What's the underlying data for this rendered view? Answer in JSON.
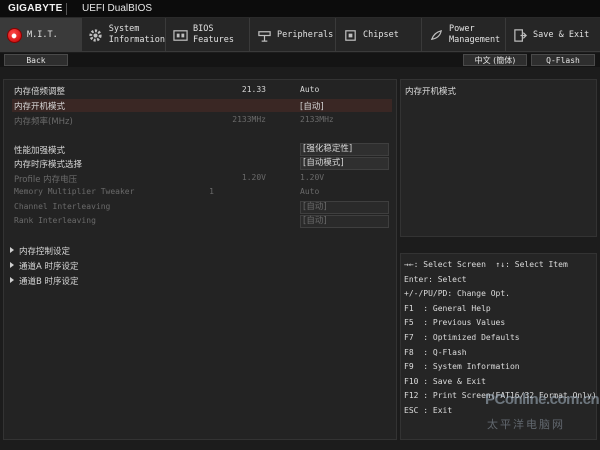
{
  "titlebar": {
    "brand": "GIGABYTE",
    "product": "UEFI DualBIOS"
  },
  "menu": [
    {
      "label": "M.I.T.",
      "icon": "mit-icon",
      "active": true
    },
    {
      "label": "System\nInformation",
      "icon": "gear-icon",
      "active": false
    },
    {
      "label": "BIOS\nFeatures",
      "icon": "bios-features-icon",
      "active": false
    },
    {
      "label": "Peripherals",
      "icon": "peripherals-icon",
      "active": false
    },
    {
      "label": "Chipset",
      "icon": "chipset-icon",
      "active": false
    },
    {
      "label": "Power\nManagement",
      "icon": "power-icon",
      "active": false
    },
    {
      "label": "Save & Exit",
      "icon": "exit-icon",
      "active": false
    }
  ],
  "subbar": {
    "back": "Back",
    "language": "中文 (簡体)",
    "qflash": "Q-Flash"
  },
  "settings": [
    {
      "name": "内存倍频调整",
      "num": "21.33",
      "value": "Auto"
    },
    {
      "name": "内存开机模式",
      "num": "",
      "value": "[自动]"
    },
    {
      "name": "内存频率(MHz)",
      "num": "2133MHz",
      "value": "2133MHz"
    },
    {
      "name": "性能加强模式",
      "num": "",
      "value": "[强化稳定性]"
    },
    {
      "name": "内存时序模式选择",
      "num": "",
      "value": "[自动模式]"
    },
    {
      "name": "Profile 内存电压",
      "num": "1.20V",
      "value": "1.20V"
    },
    {
      "name": "Memory Multiplier Tweaker",
      "num": "1",
      "value": "Auto"
    },
    {
      "name": "Channel Interleaving",
      "num": "",
      "value": "[自动]"
    },
    {
      "name": "Rank Interleaving",
      "num": "",
      "value": "[自动]"
    }
  ],
  "submenus": [
    "内存控制设定",
    "通道A 时序设定",
    "通道B 时序设定"
  ],
  "help": {
    "title": "内存开机模式"
  },
  "keys": [
    "→←: Select Screen  ↑↓: Select Item",
    "Enter: Select",
    "+/-/PU/PD: Change Opt.",
    "F1  : General Help",
    "F5  : Previous Values",
    "F7  : Optimized Defaults",
    "F8  : Q-Flash",
    "F9  : System Information",
    "F10 : Save & Exit",
    "F12 : Print Screen(FAT16/32 Format Only)",
    "ESC : Exit"
  ],
  "watermark": {
    "text": "PConline.com.cn",
    "cn": "太平洋电脑网"
  },
  "colors": {
    "accent": "#c50000",
    "selected_row": "#3a2724"
  }
}
